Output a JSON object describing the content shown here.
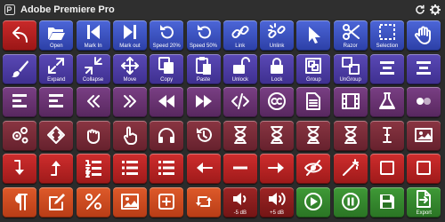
{
  "window": {
    "title": "Adobe Premiere Pro",
    "app_icon": "premiere-logo-icon",
    "actions": [
      {
        "name": "refresh-icon"
      },
      {
        "name": "gear-icon"
      }
    ]
  },
  "colors": {
    "background": "#2b2b2b",
    "row1": "#3a4fc4",
    "row2": "#4a3aa4",
    "row3": "#6a3478",
    "row4": "#7a2c3a",
    "row5": "#c22626",
    "row6": "#d04a20",
    "green": "#349030"
  },
  "buttons": [
    [
      {
        "label": "",
        "icon": "back-arrow-icon"
      },
      {
        "label": "Open",
        "icon": "folder-open-icon"
      },
      {
        "label": "Mark In",
        "icon": "mark-in-icon"
      },
      {
        "label": "Mark out",
        "icon": "mark-out-icon"
      },
      {
        "label": "Speed 20%",
        "icon": "undo-icon"
      },
      {
        "label": "Speed 50%",
        "icon": "undo-icon"
      },
      {
        "label": "Link",
        "icon": "link-icon"
      },
      {
        "label": "Unlink",
        "icon": "unlink-icon"
      },
      {
        "label": "",
        "icon": "cursor-arrow-icon"
      },
      {
        "label": "Razor",
        "icon": "scissors-icon"
      },
      {
        "label": "Selection",
        "icon": "marquee-selection-icon"
      },
      {
        "label": "",
        "icon": "hand-icon"
      }
    ],
    [
      {
        "label": "",
        "icon": "brush-icon"
      },
      {
        "label": "Expand",
        "icon": "expand-icon"
      },
      {
        "label": "Collapse",
        "icon": "collapse-icon"
      },
      {
        "label": "Move",
        "icon": "move-icon"
      },
      {
        "label": "Copy",
        "icon": "copy-icon"
      },
      {
        "label": "Paste",
        "icon": "paste-icon"
      },
      {
        "label": "Unlock",
        "icon": "unlock-icon"
      },
      {
        "label": "Lock",
        "icon": "lock-icon"
      },
      {
        "label": "Group",
        "icon": "group-icon"
      },
      {
        "label": "UnGroup",
        "icon": "ungroup-icon"
      },
      {
        "label": "",
        "icon": "align-center-icon"
      },
      {
        "label": "",
        "icon": "align-center-icon"
      }
    ],
    [
      {
        "label": "",
        "icon": "align-left-icon"
      },
      {
        "label": "",
        "icon": "align-left-icon"
      },
      {
        "label": "",
        "icon": "chevron-double-left-icon"
      },
      {
        "label": "",
        "icon": "chevron-double-right-icon"
      },
      {
        "label": "",
        "icon": "rewind-icon"
      },
      {
        "label": "",
        "icon": "fast-forward-icon"
      },
      {
        "label": "",
        "icon": "code-icon"
      },
      {
        "label": "",
        "icon": "creative-commons-icon"
      },
      {
        "label": "",
        "icon": "document-icon"
      },
      {
        "label": "",
        "icon": "film-icon"
      },
      {
        "label": "",
        "icon": "flask-icon"
      },
      {
        "label": "",
        "icon": "flickr-icon"
      }
    ],
    [
      {
        "label": "",
        "icon": "gears-icon"
      },
      {
        "label": "",
        "icon": "diamond-arrows-icon"
      },
      {
        "label": "",
        "icon": "grab-hand-icon"
      },
      {
        "label": "",
        "icon": "pointing-hand-icon"
      },
      {
        "label": "",
        "icon": "headphones-icon"
      },
      {
        "label": "",
        "icon": "history-icon"
      },
      {
        "label": "",
        "icon": "hourglass-icon"
      },
      {
        "label": "",
        "icon": "hourglass-icon"
      },
      {
        "label": "",
        "icon": "hourglass-icon"
      },
      {
        "label": "",
        "icon": "hourglass-icon"
      },
      {
        "label": "",
        "icon": "text-cursor-icon"
      },
      {
        "label": "",
        "icon": "image-icon"
      }
    ],
    [
      {
        "label": "",
        "icon": "level-down-icon"
      },
      {
        "label": "",
        "icon": "level-up-icon"
      },
      {
        "label": "",
        "icon": "numbered-list-icon"
      },
      {
        "label": "",
        "icon": "list-icon"
      },
      {
        "label": "",
        "icon": "list-icon"
      },
      {
        "label": "",
        "icon": "arrow-left-icon"
      },
      {
        "label": "",
        "icon": "minus-icon"
      },
      {
        "label": "",
        "icon": "arrow-right-icon"
      },
      {
        "label": "",
        "icon": "eye-slash-icon"
      },
      {
        "label": "",
        "icon": "magic-wand-icon"
      },
      {
        "label": "",
        "icon": "square-icon"
      },
      {
        "label": "",
        "icon": "square-icon"
      }
    ],
    [
      {
        "label": "",
        "icon": "paragraph-icon"
      },
      {
        "label": "",
        "icon": "edit-icon"
      },
      {
        "label": "",
        "icon": "percent-icon"
      },
      {
        "label": "",
        "icon": "picture-icon"
      },
      {
        "label": "",
        "icon": "plus-square-icon"
      },
      {
        "label": "",
        "icon": "retweet-icon"
      },
      {
        "label": "-5 dB",
        "icon": "volume-down-icon"
      },
      {
        "label": "+5 dB",
        "icon": "volume-up-icon"
      },
      {
        "label": "",
        "icon": "play-circle-icon"
      },
      {
        "label": "",
        "icon": "pause-circle-icon"
      },
      {
        "label": "",
        "icon": "save-icon"
      },
      {
        "label": "Export",
        "icon": "export-file-icon"
      }
    ]
  ]
}
